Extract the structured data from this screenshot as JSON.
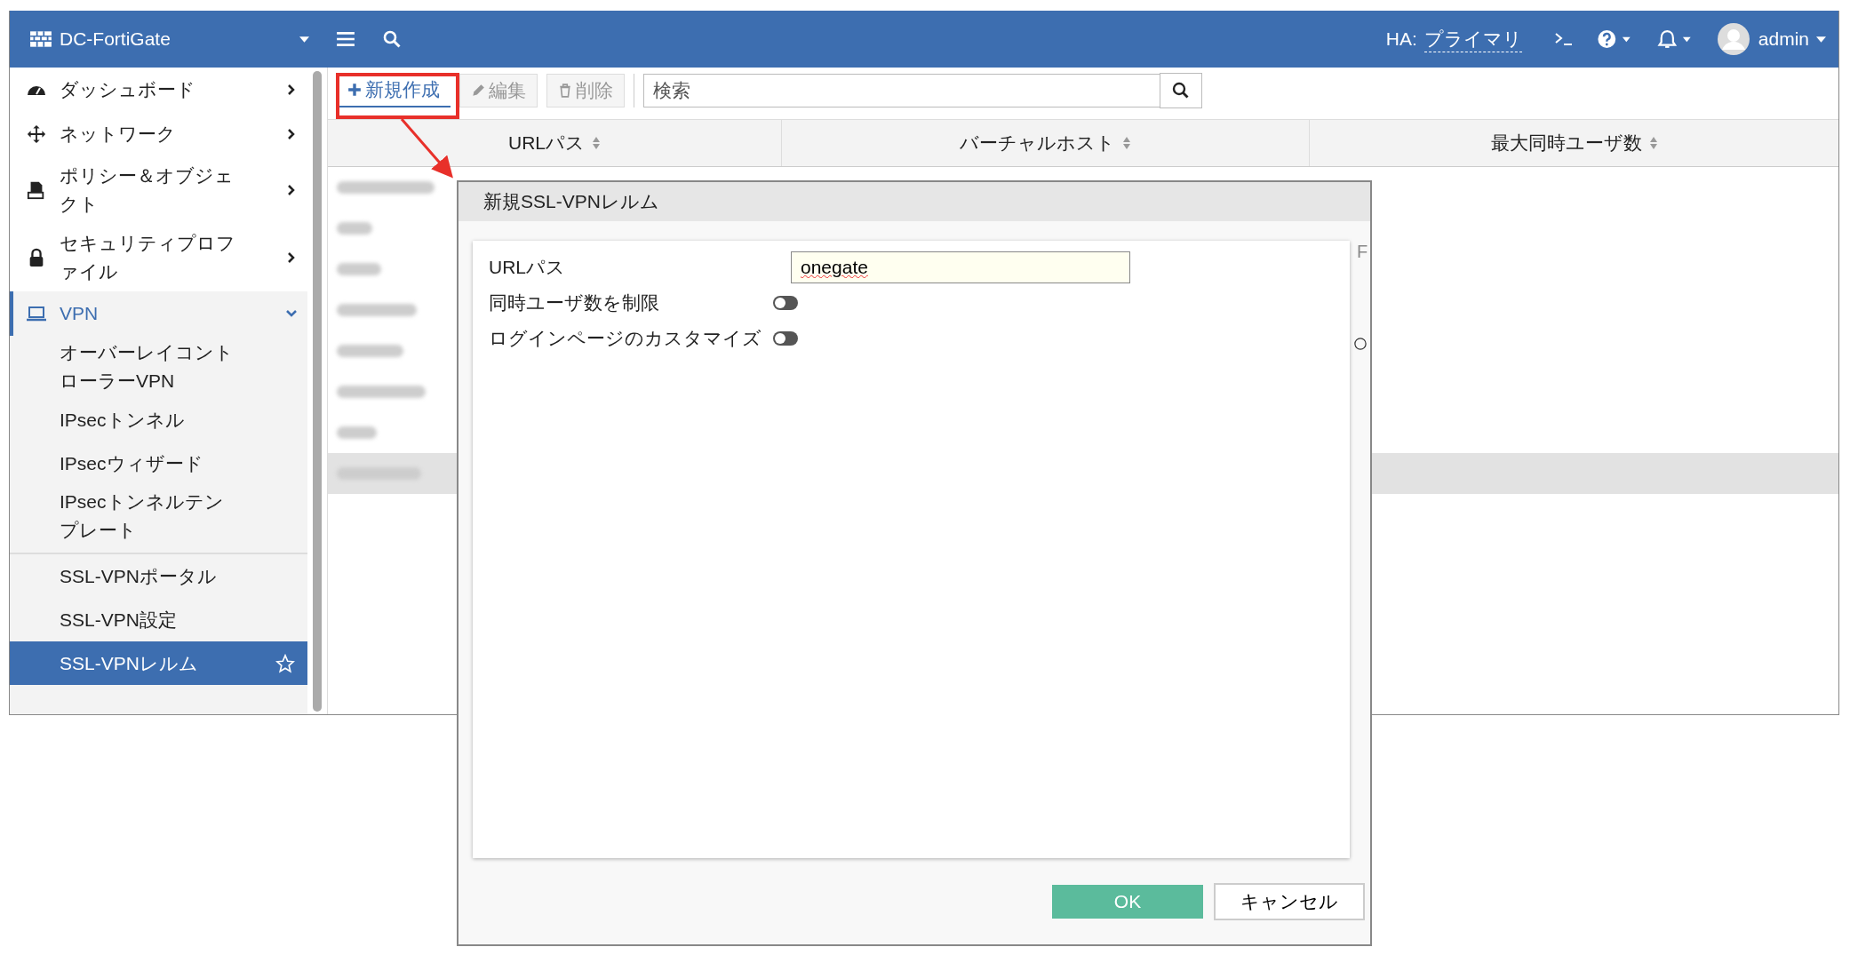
{
  "header": {
    "device": "DC-FortiGate",
    "ha_label": "HA:",
    "ha_status": "プライマリ",
    "user": "admin"
  },
  "sidebar": {
    "items": [
      {
        "label": "ダッシュボード",
        "expanded": false,
        "selected": false
      },
      {
        "label": "ネットワーク",
        "expanded": false,
        "selected": false
      },
      {
        "label": "ポリシー＆オブジェクト",
        "expanded": false,
        "selected": false
      },
      {
        "label": "セキュリティプロファイル",
        "expanded": false,
        "selected": false
      },
      {
        "label": "VPN",
        "expanded": true,
        "selected": true,
        "children": [
          {
            "label": "オーバーレイコントローラーVPN",
            "selected": false,
            "separator_above": false
          },
          {
            "label": "IPsecトンネル",
            "selected": false,
            "separator_above": false
          },
          {
            "label": "IPsecウィザード",
            "selected": false,
            "separator_above": false
          },
          {
            "label": "IPsecトンネルテンプレート",
            "selected": false,
            "separator_above": false
          },
          {
            "label": "SSL-VPNポータル",
            "selected": false,
            "separator_above": true
          },
          {
            "label": "SSL-VPN設定",
            "selected": false,
            "separator_above": false
          },
          {
            "label": "SSL-VPNレルム",
            "selected": true,
            "separator_above": false
          }
        ]
      }
    ]
  },
  "toolbar": {
    "buttons": [
      {
        "label": "新規作成",
        "kind": "create",
        "disabled": false
      },
      {
        "label": "編集",
        "kind": "edit",
        "disabled": true
      },
      {
        "label": "削除",
        "kind": "delete",
        "disabled": true
      }
    ],
    "search": {
      "placeholder": "検索"
    }
  },
  "table": {
    "columns": [
      "URLパス",
      "バーチャルホスト",
      "最大同時ユーザ数"
    ],
    "rows": [
      {
        "selected": false
      },
      {
        "selected": false
      },
      {
        "selected": false
      },
      {
        "selected": false
      },
      {
        "selected": false
      },
      {
        "selected": false
      },
      {
        "selected": false
      },
      {
        "selected": true
      }
    ]
  },
  "dialog": {
    "title": "新規SSL-VPNレルム",
    "fields": [
      {
        "kind": "text",
        "label": "URLパス",
        "value": "onegate"
      },
      {
        "kind": "toggle",
        "label": "同時ユーザ数を制限",
        "on": false
      },
      {
        "kind": "toggle",
        "label": "ログインページのカスタマイズ",
        "on": false
      }
    ],
    "side_text": "F",
    "buttons": [
      {
        "label": "OK",
        "kind": "primary"
      },
      {
        "label": "キャンセル",
        "kind": "secondary"
      }
    ]
  }
}
